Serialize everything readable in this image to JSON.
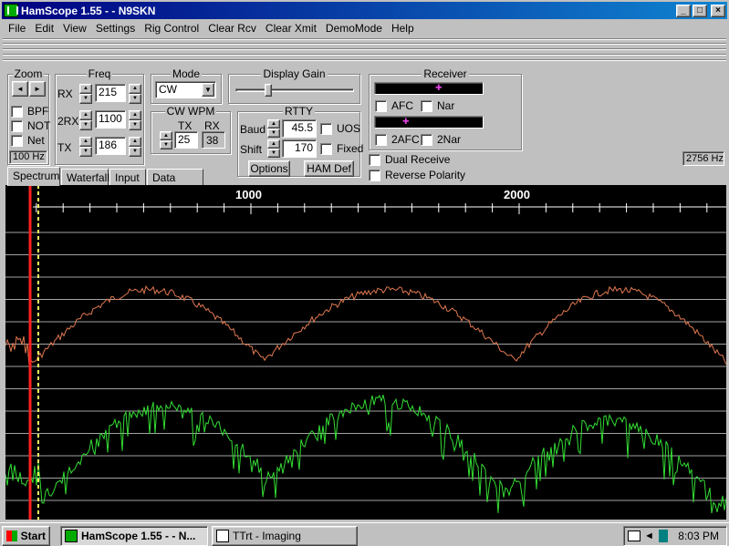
{
  "window": {
    "title": "HamScope 1.55 - - N9SKN",
    "min_label": "_",
    "max_label": "□",
    "close_label": "×"
  },
  "menu": [
    "File",
    "Edit",
    "View",
    "Settings",
    "Rig Control",
    "Clear Rcv",
    "Clear Xmit",
    "DemoMode",
    "Help"
  ],
  "zoom": {
    "label": "Zoom",
    "left": "◄",
    "right": "►",
    "value": "100 Hz",
    "bpf": "BPF",
    "not": "NOT",
    "net": "Net"
  },
  "freq": {
    "label": "Freq",
    "rx_label": "RX",
    "rx": "215",
    "rx2_label": "2RX",
    "rx2": "1100",
    "tx_label": "TX",
    "tx": "186"
  },
  "mode": {
    "label": "Mode",
    "value": "CW"
  },
  "cwwpm": {
    "label": "CW WPM",
    "tx_label": "TX",
    "rx_label": "RX",
    "tx": "25",
    "rx": "38"
  },
  "gain": {
    "label": "Display Gain",
    "level": 0.3
  },
  "rtty": {
    "label": "RTTY",
    "baud_label": "Baud",
    "baud": "45.5",
    "uos": "UOS",
    "shift_label": "Shift",
    "shift": "170",
    "fixed": "Fixed",
    "options": "Options",
    "hamdef": "HAM Def"
  },
  "receiver": {
    "label": "Receiver",
    "afc": "AFC",
    "nar": "Nar",
    "afc2": "2AFC",
    "nar2": "2Nar",
    "dual": "Dual Receive",
    "reverse": "Reverse Polarity",
    "freq": "2756 Hz"
  },
  "tabs": [
    "Spectrum",
    "Waterfall",
    "Input",
    "Data Sync"
  ],
  "spectrum": {
    "tick_1000": "1000",
    "tick_2000": "2000",
    "colors": {
      "top": "#e07850",
      "bottom": "#33dd33",
      "marker": "#ff2020",
      "cursor": "#ffff60"
    }
  },
  "taskbar": {
    "start": "Start",
    "task1": "HamScope 1.55 - - N...",
    "task2": "TTrt - Imaging",
    "clock": "8:03 PM"
  }
}
